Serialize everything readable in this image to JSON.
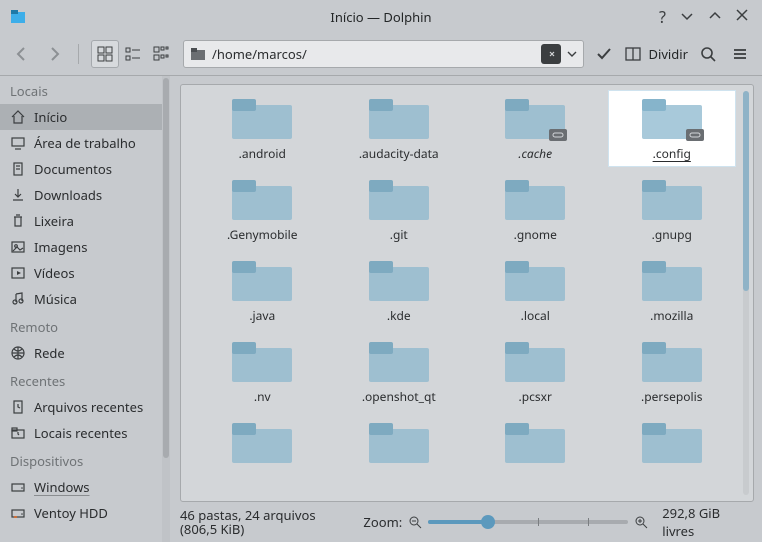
{
  "window": {
    "title": "Início — Dolphin"
  },
  "toolbar": {
    "path": "/home/marcos/",
    "split_label": "Dividir"
  },
  "sidebar": {
    "sections": [
      {
        "heading": "Locais",
        "items": [
          {
            "icon": "home",
            "label": "Início",
            "selected": true
          },
          {
            "icon": "desktop",
            "label": "Área de trabalho"
          },
          {
            "icon": "documents",
            "label": "Documentos"
          },
          {
            "icon": "downloads",
            "label": "Downloads"
          },
          {
            "icon": "trash",
            "label": "Lixeira"
          },
          {
            "icon": "images",
            "label": "Imagens"
          },
          {
            "icon": "videos",
            "label": "Vídeos"
          },
          {
            "icon": "music",
            "label": "Música"
          }
        ]
      },
      {
        "heading": "Remoto",
        "items": [
          {
            "icon": "network",
            "label": "Rede"
          }
        ]
      },
      {
        "heading": "Recentes",
        "items": [
          {
            "icon": "recent-files",
            "label": "Arquivos recentes"
          },
          {
            "icon": "recent-places",
            "label": "Locais recentes"
          }
        ]
      },
      {
        "heading": "Dispositivos",
        "items": [
          {
            "icon": "drive",
            "label": "Windows",
            "linkish": true
          },
          {
            "icon": "drive-usb",
            "label": "Ventoy HDD"
          }
        ]
      }
    ]
  },
  "files": [
    {
      "name": ".android"
    },
    {
      "name": ".audacity-data"
    },
    {
      "name": ".cache",
      "italic": true,
      "link": true
    },
    {
      "name": ".config",
      "italic": true,
      "link": true,
      "selected": true
    },
    {
      "name": ".Genymobile"
    },
    {
      "name": ".git"
    },
    {
      "name": ".gnome"
    },
    {
      "name": ".gnupg"
    },
    {
      "name": ".java"
    },
    {
      "name": ".kde"
    },
    {
      "name": ".local"
    },
    {
      "name": ".mozilla"
    },
    {
      "name": ".nv"
    },
    {
      "name": ".openshot_qt"
    },
    {
      "name": ".pcsxr"
    },
    {
      "name": ".persepolis"
    },
    {
      "name": ""
    },
    {
      "name": ""
    },
    {
      "name": ""
    },
    {
      "name": ""
    }
  ],
  "status": {
    "summary": "46 pastas, 24 arquivos (806,5 KiB)",
    "zoom_label": "Zoom:",
    "free": "292,8 GiB livres"
  }
}
